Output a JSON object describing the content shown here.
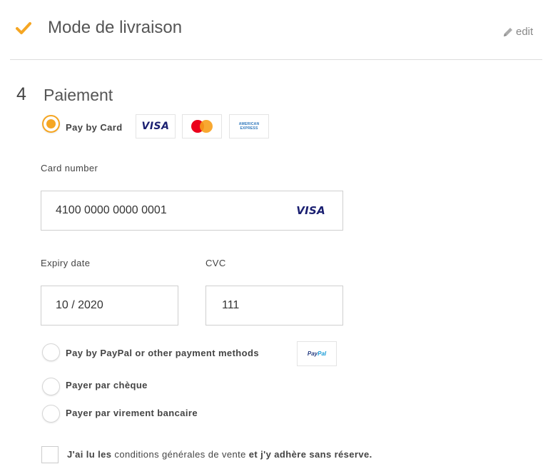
{
  "step3": {
    "title": "Mode de livraison",
    "edit_label": "edit",
    "check_icon": "check-icon",
    "edit_icon": "pencil-icon"
  },
  "step4": {
    "number": "4",
    "title": "Paiement"
  },
  "payment_methods": {
    "card": {
      "label": "Pay by Card",
      "selected": true,
      "logos": {
        "visa": "VISA",
        "mastercard": "mastercard-logo",
        "amex_line1": "AMERICAN",
        "amex_line2": "EXPRESS"
      }
    },
    "paypal": {
      "label": "Pay by PayPal or other payment methods",
      "selected": false,
      "logo_part1": "Pay",
      "logo_part2": "Pal"
    },
    "cheque": {
      "label": "Payer par chèque",
      "selected": false
    },
    "virement": {
      "label": "Payer par virement bancaire",
      "selected": false
    }
  },
  "card_form": {
    "card_number_label": "Card number",
    "card_number_value": "4100 0000 0000 0001",
    "card_brand": "VISA",
    "expiry_label": "Expiry date",
    "expiry_value": "10 / 2020",
    "cvc_label": "CVC",
    "cvc_value": "111"
  },
  "terms": {
    "part1": "J'ai lu les",
    "part2": " conditions générales de vente ",
    "part3": "et j'y adhère sans réserve.",
    "checked": false
  },
  "colors": {
    "accent": "#f5a623",
    "visa_blue": "#1a1f71",
    "border": "#cfcfcf"
  }
}
